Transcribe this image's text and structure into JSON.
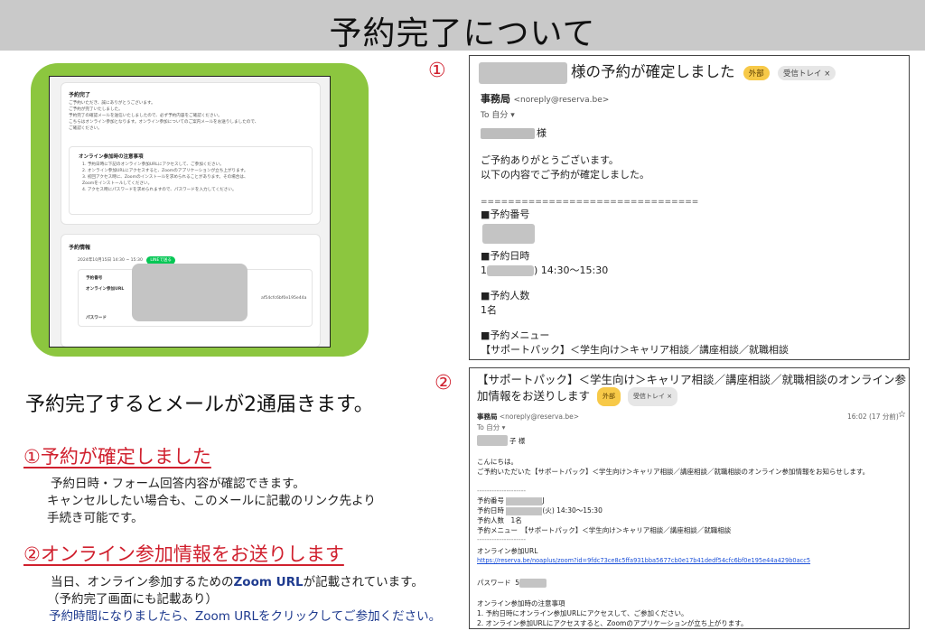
{
  "title": "予約完了について",
  "left_screen": {
    "card1": {
      "heading": "予約完了",
      "lines": [
        "ご予約いただき、誠にありがとうございます。",
        "ご予約が完了いたしました。",
        "予約完了の確認メールを送信いたしましたので、必ず予約内容をご確認ください。",
        "こちらはオンライン参加となります。オンライン参加についてのご案内メールをお送りしましたので、",
        "ご確認ください。"
      ],
      "notes_heading": "オンライン参加時の注意事項",
      "notes": [
        "1. 予約日時に下記のオンライン参加URLにアクセスして、ご参加ください。",
        "2. オンライン参加URLにアクセスすると、Zoomのアプリケーションが立ち上がります。",
        "3. 初回アクセス時に、Zoomのインストールを求められることがあります。その場合は、",
        "Zoomをインストールしてください。",
        "4. アクセス時にパスワードを求められますので、パスワードを入力してください。"
      ]
    },
    "card2": {
      "heading": "予約情報",
      "datetime": "2024年10月15日 14:30 ~ 15:30",
      "line_button": "LINEで送る",
      "label_number": "予約番号",
      "label_url": "オンライン参加URL",
      "url_tail": "af54cfc6bf0e195e44a",
      "label_password": "パスワード"
    }
  },
  "lead": "予約完了するとメールが2通届きます。",
  "section1": {
    "heading": "①予約が確定しました",
    "lines": [
      "予約日時・フォーム回答内容が確認できます。",
      "キャンセルしたい場合も、このメールに記載のリンク先より",
      "手続き可能です。"
    ]
  },
  "section2": {
    "heading": "②オンライン参加情報をお送りします",
    "line1_a": "当日、オンライン参加するための",
    "line1_b": "Zoom URL",
    "line1_c": "が記載されています。",
    "line2": "（予約完了画面にも記載あり）",
    "line3": "予約時間になりましたら、Zoom URLをクリックしてご参加ください。"
  },
  "mail1": {
    "number": "①",
    "subject": "様の予約が確定しました",
    "badge_external": "外部",
    "badge_inbox": "受信トレイ ×",
    "sender_name": "事務局",
    "sender_email": "<noreply@reserva.be>",
    "to": "To 自分 ▾",
    "salutation": "様",
    "body1": "ご予約ありがとうございます。",
    "body2": "以下の内容でご予約が確定しました。",
    "divider": "================================",
    "label_number": "■予約番号",
    "label_datetime": "■予約日時",
    "datetime_tail": ") 14:30～15:30",
    "label_people": "■予約人数",
    "people": "1名",
    "label_menu": "■予約メニュー",
    "menu": "【サポートパック】＜学生向け＞キャリア相談／講座相談／就職相談"
  },
  "mail2": {
    "number": "②",
    "subject_line1": "【サポートパック】＜学生向け＞キャリア相談／講座相談／就職相談のオンライン参",
    "subject_line2": "加情報をお送りします",
    "badge_external": "外部",
    "badge_inbox": "受信トレイ ×",
    "sender_name": "事務局",
    "sender_email": "<noreply@reserva.be>",
    "time": "16:02 (17 分前)",
    "star": "☆",
    "to": "To 自分 ▾",
    "salutation": "子 様",
    "greeting": "こんにちは。",
    "body": "ご予約いただいた【サポートパック】＜学生向け＞キャリア相談／講座相談／就職相談のオンライン参加情報をお知らせします。",
    "divider1": "--------------------",
    "row_number": "予約番号",
    "row_number_tail": "J",
    "row_datetime": "予約日時",
    "row_datetime_tail": "(火) 14:30～15:30",
    "row_people": "予約人数　1名",
    "row_menu": "予約メニュー　【サポートパック】＜学生向け＞キャリア相談／講座相談／就職相談",
    "divider2": "--------------------",
    "url_label": "オンライン参加URL",
    "url": "https://reserva.be/noaplus/zoom?id=9fdc73ce8c5ffa931bba5677cb0e17b41dedf54cfc6bf0e195e44a429b0acc5",
    "password_label": "パスワード",
    "password_head": "5",
    "notes_heading": "オンライン参加時の注意事項",
    "note1": "1. 予約日時にオンライン参加URLにアクセスして、ご参加ください。",
    "note2": "2. オンライン参加URLにアクセスすると、Zoomのアプリケーションが立ち上がります。"
  },
  "colors": {
    "accent_red": "#d0202e",
    "green_frame": "#8cc63f",
    "zoom_blue": "#1f3b8f",
    "line_green": "#06c755"
  }
}
